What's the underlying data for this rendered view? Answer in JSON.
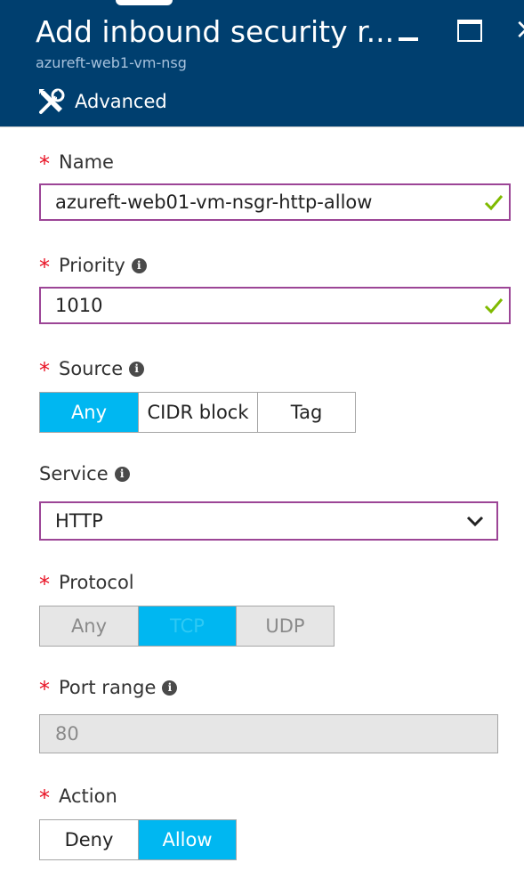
{
  "header": {
    "title": "Add inbound security r...",
    "subtitle": "azureft-web1-vm-nsg",
    "advanced_label": "Advanced",
    "close_glyph": "×"
  },
  "form": {
    "name": {
      "required": "*",
      "label": "Name",
      "value": "azureft-web01-vm-nsgr-http-allow",
      "valid": true
    },
    "priority": {
      "required": "*",
      "label": "Priority",
      "value": "1010",
      "valid": true
    },
    "source": {
      "required": "*",
      "label": "Source",
      "options": [
        "Any",
        "CIDR block",
        "Tag"
      ],
      "selected": "Any"
    },
    "service": {
      "label": "Service",
      "value": "HTTP"
    },
    "protocol": {
      "required": "*",
      "label": "Protocol",
      "options": [
        "Any",
        "TCP",
        "UDP"
      ],
      "selected": "TCP",
      "disabled": true
    },
    "port_range": {
      "required": "*",
      "label": "Port range",
      "value": "80",
      "disabled": true
    },
    "action": {
      "required": "*",
      "label": "Action",
      "options": [
        "Deny",
        "Allow"
      ],
      "selected": "Allow"
    }
  },
  "icons": {
    "info": "info-icon",
    "check": "checkmark-icon",
    "chevron": "chevron-down-icon",
    "advanced": "wrench-screwdriver-icon"
  },
  "colors": {
    "header_bg": "#003f6f",
    "accent_selected": "#00b7f1",
    "input_border": "#9c4596",
    "required": "#e81123",
    "valid_check": "#7fba00",
    "disabled_bg": "#e6e6e6"
  }
}
